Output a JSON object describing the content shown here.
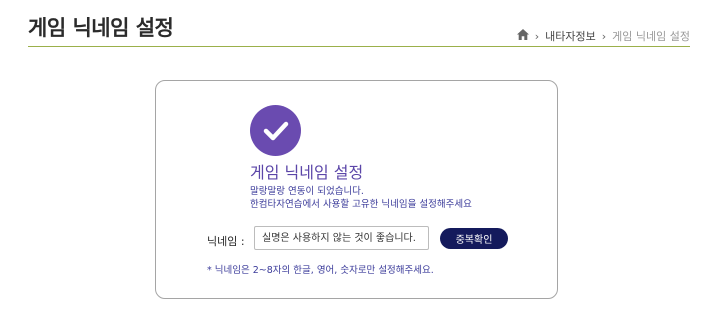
{
  "header": {
    "title": "게임 닉네임 설정",
    "breadcrumb": [
      "내타자정보",
      "게임 닉네임 설정"
    ]
  },
  "card": {
    "icon": "check-icon",
    "title": "게임 닉네임 설정",
    "description_lines": [
      "말랑말랑 연동이 되었습니다.",
      "한컴타자연습에서 사용할 고유한 닉네임을 설정해주세요"
    ],
    "nickname_label": "닉네임 :",
    "nickname_placeholder": "실명은 사용하지 않는 것이 좋습니다.",
    "check_button": "중복확인",
    "hint": "* 닉네임은 2~8자의 한글, 영어, 숫자로만 설정해주세요."
  },
  "colors": {
    "accent": "#6a4bb0",
    "button": "#141a5c",
    "rule": "#9bb04a",
    "hint_text": "#3b3b9a"
  }
}
